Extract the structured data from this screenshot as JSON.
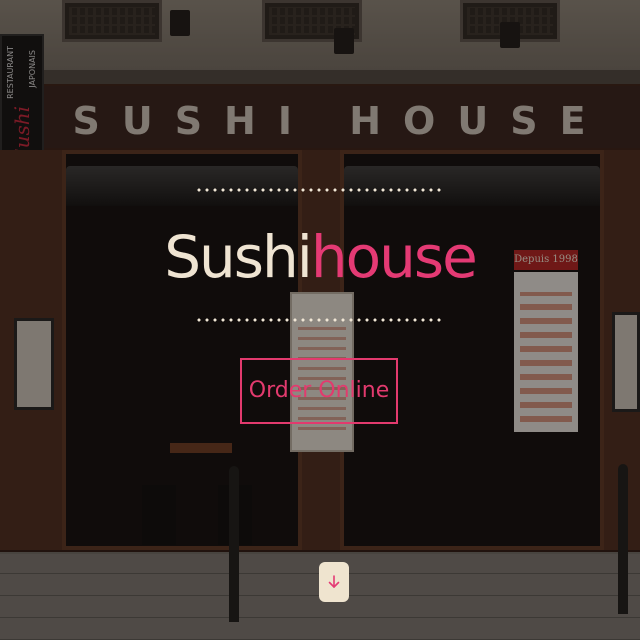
{
  "storefront": {
    "sign_text": "SUSHI HOUSE",
    "side_sign_top": "RESTAURANT",
    "side_sign_main": "Sushi",
    "side_sign_bottom": "JAPONAIS",
    "window_banner": "Depuis 1998"
  },
  "hero": {
    "title_part1": "Sushi",
    "title_part2": "house",
    "order_button_label": "Order Online",
    "scroll_icon": "arrow-down-icon"
  },
  "colors": {
    "accent": "#e43a74",
    "title_light": "#efe4d2",
    "scroll_button_bg": "#efe4cf"
  }
}
